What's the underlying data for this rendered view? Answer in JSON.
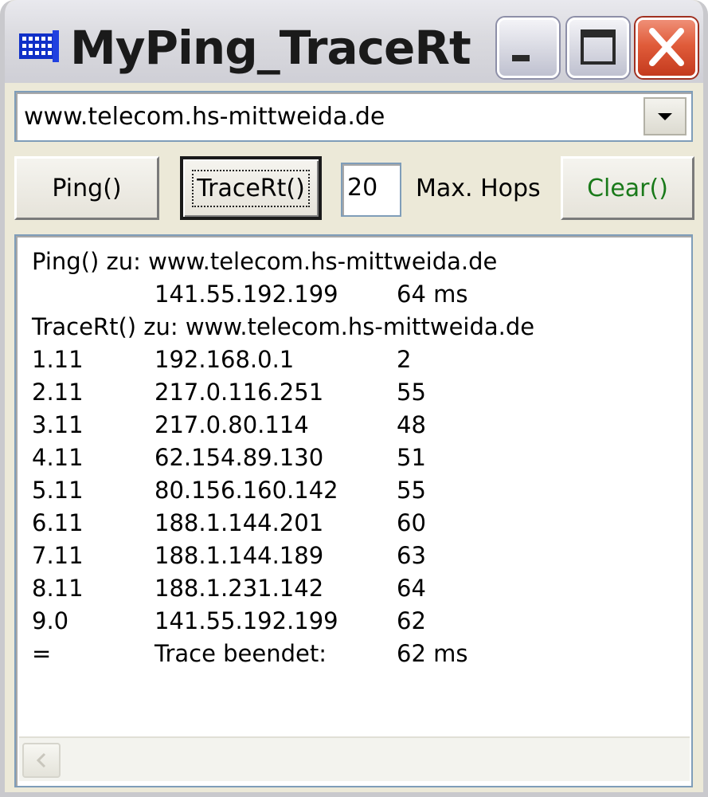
{
  "window": {
    "title": "MyPing_TraceRt",
    "icon": "network-grid-icon",
    "controls": [
      "minimize-icon",
      "maximize-icon",
      "close-icon"
    ]
  },
  "host": {
    "value": "www.telecom.hs-mittweida.de"
  },
  "toolbar": {
    "ping_label": "Ping()",
    "trace_label": "TraceRt()",
    "max_hops_value": "20",
    "max_hops_label": "Max. Hops",
    "clear_label": "Clear()"
  },
  "output": {
    "lines": [
      [
        "Ping() zu: www.telecom.hs-mittweida.de",
        "",
        ""
      ],
      [
        "",
        "141.55.192.199",
        "64 ms"
      ],
      [
        "TraceRt() zu: www.telecom.hs-mittweida.de",
        "",
        ""
      ],
      [
        "1.11",
        "192.168.0.1",
        "2"
      ],
      [
        "2.11",
        "217.0.116.251",
        "55"
      ],
      [
        "3.11",
        "217.0.80.114",
        "48"
      ],
      [
        "4.11",
        "62.154.89.130",
        "51"
      ],
      [
        "5.11",
        "80.156.160.142",
        "55"
      ],
      [
        "6.11",
        "188.1.144.201",
        "60"
      ],
      [
        "7.11",
        "188.1.144.189",
        "63"
      ],
      [
        "8.11",
        "188.1.231.142",
        "64"
      ],
      [
        "9.0",
        "141.55.192.199",
        "62"
      ],
      [
        "=",
        "Trace beendet:",
        "62 ms"
      ]
    ]
  },
  "colors": {
    "clear_text": "#1a7a1a",
    "close_button": "#e05c3a"
  }
}
